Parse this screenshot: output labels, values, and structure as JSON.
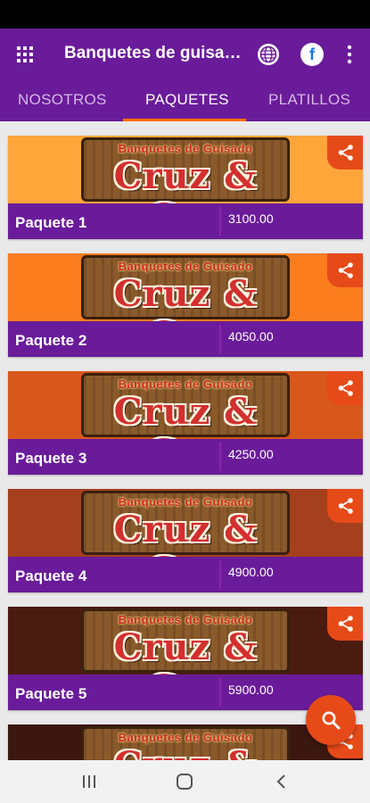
{
  "app_bar": {
    "title": "Banquetes de guisado Cruz & Gar",
    "facebook_glyph": "f"
  },
  "tabs": [
    {
      "label": "NOSOTROS"
    },
    {
      "label": "PAQUETES"
    },
    {
      "label": "PLATILLOS"
    }
  ],
  "logo": {
    "line1": "Banquetes de Guisado",
    "line2": "Cruz & Gar"
  },
  "packages": [
    {
      "name": "Paquete 1",
      "price": "3100.00",
      "color": "#ffa53a"
    },
    {
      "name": "Paquete 2",
      "price": "4050.00",
      "color": "#fb7d1e"
    },
    {
      "name": "Paquete 3",
      "price": "4250.00",
      "color": "#d8571b"
    },
    {
      "name": "Paquete 4",
      "price": "4900.00",
      "color": "#a5401f"
    },
    {
      "name": "Paquete 5",
      "price": "5900.00",
      "color": "#4a1c10"
    },
    {
      "name": "",
      "price": "",
      "color": "#3b1710"
    }
  ],
  "colors": {
    "primary": "#6a1b9a",
    "accent": "#e64a19",
    "tab_indicator": "#ff6d00"
  },
  "icons": {
    "grid": "apps-grid-icon",
    "web": "globe-icon",
    "facebook": "facebook-icon",
    "more": "more-vert-icon",
    "share": "share-icon",
    "search": "search-icon"
  }
}
